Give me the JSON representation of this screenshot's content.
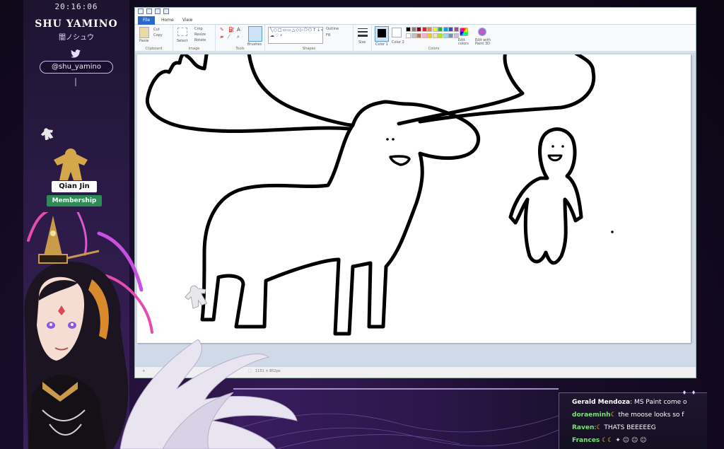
{
  "overlay": {
    "clock": "20:16:06",
    "streamer_name": "SHU YAMINO",
    "streamer_sub": "闇ノシュウ",
    "twitter_handle": "@shu_yamino",
    "viewer_name": "Qian Jin",
    "membership_label": "Membership"
  },
  "paint": {
    "tabs": [
      "File",
      "Home",
      "View"
    ],
    "active_tab": "File",
    "ribbon": {
      "paste_label": "Paste",
      "cut_label": "Cut",
      "copy_label": "Copy",
      "select_label": "Select",
      "crop_label": "Crop",
      "resize_label": "Resize",
      "rotate_label": "Rotate",
      "brushes_label": "Brushes",
      "outline_label": "Outline",
      "fill_label": "Fill",
      "size_label": "Size",
      "color1_label": "Color 1",
      "color2_label": "Color 2",
      "edit_colors_label": "Edit colors",
      "edit_3d_label": "Edit with Paint 3D",
      "groups": [
        "Clipboard",
        "Image",
        "Tools",
        "Shapes",
        "Colors"
      ]
    },
    "palette": [
      "#000000",
      "#7f7f7f",
      "#880015",
      "#ed1c24",
      "#ff7f27",
      "#fff200",
      "#22b14c",
      "#00a2e8",
      "#3f48cc",
      "#a349a4",
      "#ffffff",
      "#c3c3c3",
      "#b97a57",
      "#ffaec9",
      "#ffc90e",
      "#efe4b0",
      "#b5e61d",
      "#99d9ea",
      "#7092be",
      "#c8bfe7"
    ],
    "status": {
      "size": "1151 × 802px"
    }
  },
  "chat": {
    "messages": [
      {
        "author": "Gerald Mendoza",
        "text": ": MS Paint come o",
        "author_color": "#ffffff"
      },
      {
        "author": "doraeminh",
        "text": " the moose looks so f",
        "author_color": "#7ee07e"
      },
      {
        "author": "Raven",
        "text": " THATS BEEEEEG",
        "author_color": "#7ee07e"
      },
      {
        "author": "Frances",
        "text": "",
        "author_color": "#7ee07e"
      }
    ]
  }
}
